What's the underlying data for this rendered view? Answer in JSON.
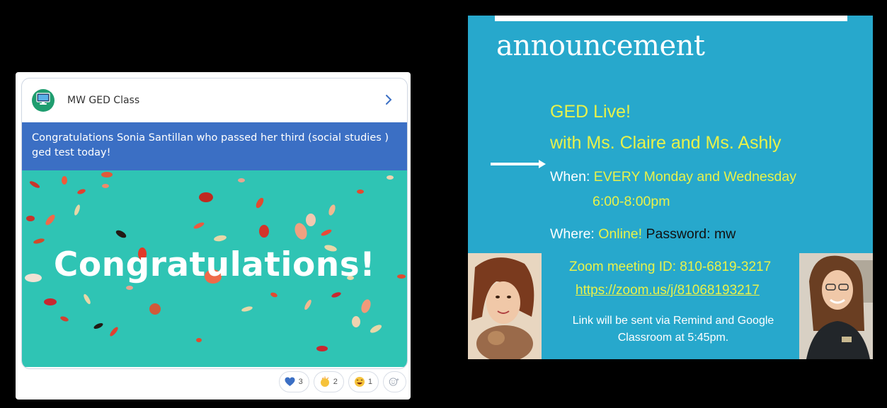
{
  "post": {
    "class_name": "MW GED Class",
    "message": "Congratulations Sonia Santillan who passed her third (social studies ) ged test today!",
    "image_text": "Congratulations!",
    "reactions": [
      {
        "icon": "heart-icon",
        "count": "3"
      },
      {
        "icon": "clap-icon",
        "count": "2"
      },
      {
        "icon": "laugh-icon",
        "count": "1"
      },
      {
        "icon": "add-reaction-icon",
        "count": ""
      }
    ]
  },
  "slide": {
    "heading": "announcement",
    "title_line1": "GED Live!",
    "title_line2": "with Ms. Claire and Ms. Ashly",
    "when_label": "When:",
    "when_value": "EVERY Monday and Wednesday",
    "time": "6:00-8:00pm",
    "where_label": "Where:",
    "where_value": "Online!",
    "password": "Password: mw",
    "zoom_id": "Zoom meeting ID: 810-6819-3217",
    "zoom_link": "https://zoom.us/j/81068193217",
    "sent_line1": "Link will be sent via Remind and Google",
    "sent_line2": "Classroom at 5:45pm."
  },
  "colors": {
    "post_banner": "#3b6fc4",
    "confetti_bg": "#2fc4b4",
    "slide_bg": "#27a8cc",
    "slide_highlight": "#e9f24a"
  }
}
